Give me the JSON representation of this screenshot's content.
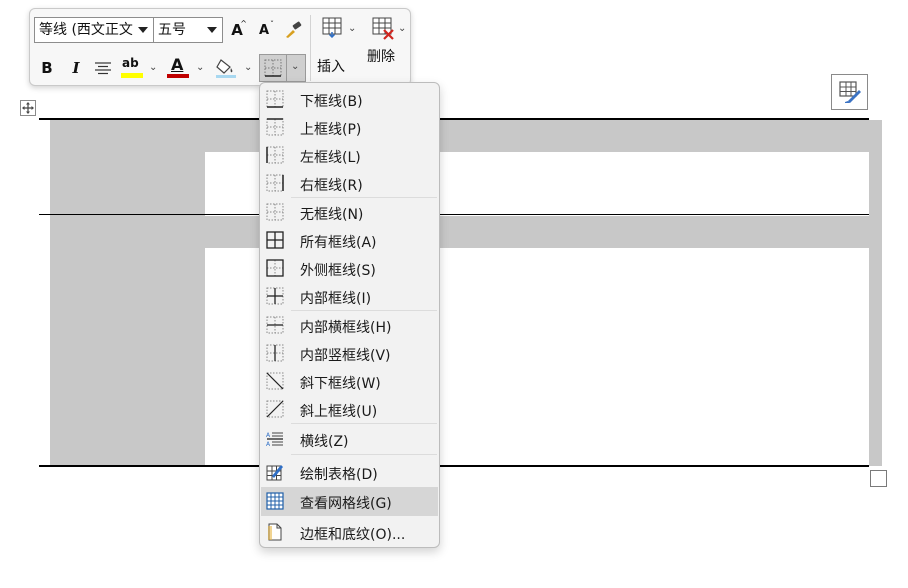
{
  "toolbar": {
    "font_name": "等线 (西文正文",
    "font_size": "五号",
    "grow_font_label": "A",
    "shrink_font_label": "A",
    "bold_label": "B",
    "italic_label": "I",
    "highlight_label": "ab",
    "font_color_label": "A",
    "insert_label": "插入",
    "delete_label": "删除",
    "highlight_color": "#ffff00",
    "font_color": "#c00000"
  },
  "border_menu": {
    "items": [
      {
        "label": "下框线(B)",
        "icon": "bottom-border-icon"
      },
      {
        "label": "上框线(P)",
        "icon": "top-border-icon"
      },
      {
        "label": "左框线(L)",
        "icon": "left-border-icon"
      },
      {
        "label": "右框线(R)",
        "icon": "right-border-icon"
      },
      {
        "label": "无框线(N)",
        "icon": "no-border-icon"
      },
      {
        "label": "所有框线(A)",
        "icon": "all-borders-icon"
      },
      {
        "label": "外侧框线(S)",
        "icon": "outside-borders-icon"
      },
      {
        "label": "内部框线(I)",
        "icon": "inside-borders-icon"
      },
      {
        "label": "内部横框线(H)",
        "icon": "inside-horizontal-border-icon"
      },
      {
        "label": "内部竖框线(V)",
        "icon": "inside-vertical-border-icon"
      },
      {
        "label": "斜下框线(W)",
        "icon": "diagonal-down-border-icon"
      },
      {
        "label": "斜上框线(U)",
        "icon": "diagonal-up-border-icon"
      },
      {
        "label": "横线(Z)",
        "icon": "horizontal-line-icon"
      },
      {
        "label": "绘制表格(D)",
        "icon": "draw-table-icon"
      },
      {
        "label": "查看网格线(G)",
        "icon": "view-gridlines-icon"
      },
      {
        "label": "边框和底纹(O)...",
        "icon": "borders-shading-icon"
      }
    ],
    "highlighted": "查看网格线(G)"
  }
}
